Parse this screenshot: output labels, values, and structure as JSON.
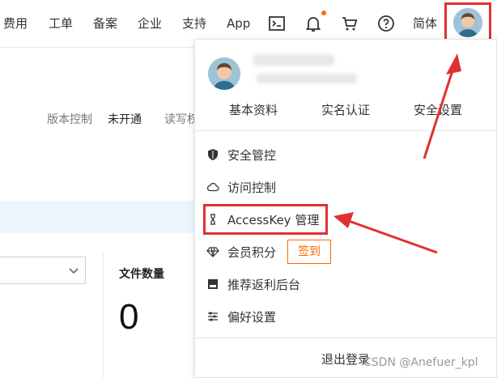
{
  "nav": {
    "items": [
      "费用",
      "工单",
      "备案",
      "企业",
      "支持",
      "App"
    ],
    "lang": "简体"
  },
  "page": {
    "version_label": "版本控制",
    "version_value": "未开通",
    "rw_label": "读写权",
    "file_count_label": "文件数量",
    "file_count_value": "0"
  },
  "menu": {
    "profile_links": [
      "基本资料",
      "实名认证",
      "安全设置"
    ],
    "items": [
      "安全管控",
      "访问控制",
      "AccessKey 管理",
      "会员积分",
      "推荐返利后台",
      "偏好设置"
    ],
    "signin_label": "签到",
    "logout_label": "退出登录"
  },
  "watermark": "CSDN @Anefuer_kpl",
  "colors": {
    "accent": "#ff6a00",
    "highlight": "#e03131",
    "info_strip": "#eef5fd"
  },
  "icons": {
    "nav": [
      "terminal-icon",
      "bell-icon",
      "cart-icon",
      "help-icon"
    ],
    "menu": [
      "shield-icon",
      "cloud-icon",
      "key-icon",
      "diamond-icon",
      "gift-card-icon",
      "sliders-icon"
    ]
  }
}
